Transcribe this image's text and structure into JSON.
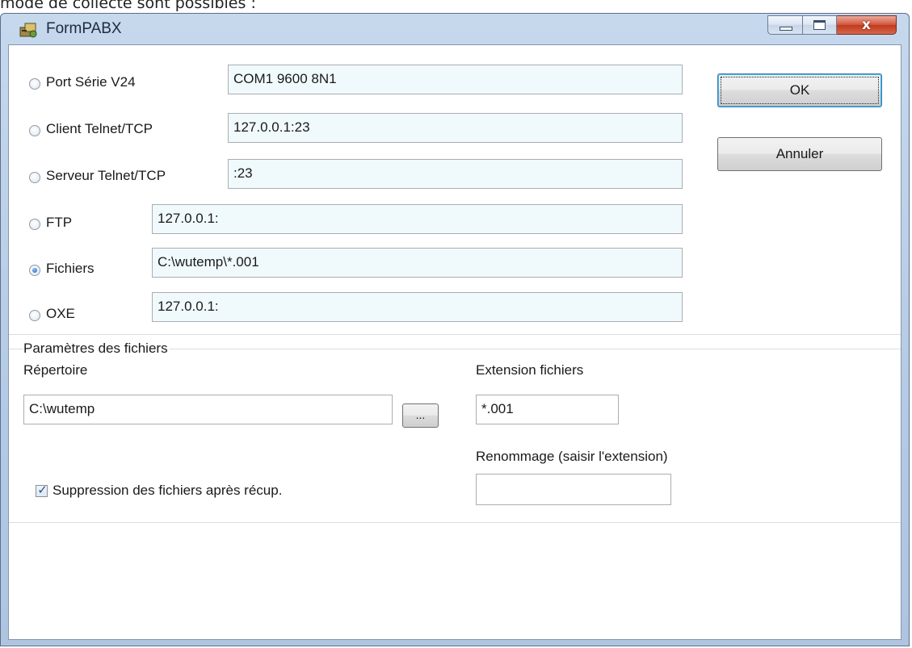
{
  "doc_line": "mode de collecte sont possibles :",
  "window": {
    "title": "FormPABX",
    "close_glyph": "x"
  },
  "connections": [
    {
      "label": "Port Série V24",
      "value": "COM1 9600 8N1",
      "checked": false
    },
    {
      "label": "Client Telnet/TCP",
      "value": "127.0.0.1:23",
      "checked": false
    },
    {
      "label": "Serveur Telnet/TCP",
      "value": ":23",
      "checked": false
    },
    {
      "label": "FTP",
      "value": "127.0.0.1:",
      "checked": false
    },
    {
      "label": "Fichiers",
      "value": "C:\\wutemp\\*.001",
      "checked": true
    },
    {
      "label": "OXE",
      "value": "127.0.0.1:",
      "checked": false
    }
  ],
  "buttons": {
    "ok": "OK",
    "cancel": "Annuler",
    "browse": "..."
  },
  "files_group": {
    "title": "Paramètres des fichiers",
    "directory_label": "Répertoire",
    "directory_value": "C:\\wutemp",
    "extension_label": "Extension fichiers",
    "extension_value": "*.001",
    "rename_label": "Renommage (saisir l'extension)",
    "rename_value": "",
    "delete_label": "Suppression des fichiers après récup.",
    "delete_checked": true,
    "check_glyph": "✓"
  },
  "icons": [
    "app-icon",
    "minimize-icon",
    "maximize-icon",
    "close-icon",
    "checkmark-icon"
  ]
}
